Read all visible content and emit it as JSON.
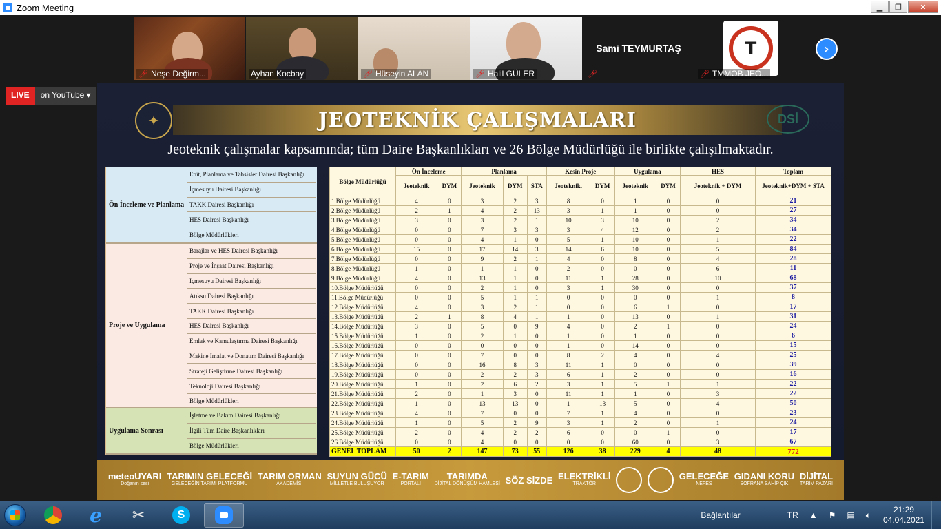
{
  "window": {
    "title": "Zoom Meeting"
  },
  "participants": [
    {
      "name": "Neşe Değirm...",
      "muted": true
    },
    {
      "name": "Ayhan Kocbay",
      "muted": false
    },
    {
      "name": "Hüseyin ALAN",
      "muted": true
    },
    {
      "name": "Halil GÜLER",
      "muted": true
    },
    {
      "name": "Sami TEYMURTAŞ",
      "muted": true
    },
    {
      "name": "TMMOB JEO...",
      "muted": true
    }
  ],
  "live": {
    "badge": "LIVE",
    "where": "on YouTube"
  },
  "slide": {
    "title": "JEOTEKNİK ÇALIŞMALARI",
    "subtitle": "Jeoteknik çalışmalar kapsamında; tüm Daire Başkanlıkları ve 26 Bölge Müdürlüğü ile birlikte çalışılmaktadır.",
    "logo_right": "DSİ",
    "groups": [
      {
        "label": "Ön İnceleme ve Planlama",
        "items": [
          "Etüt, Planlama ve Tahsisler Dairesi Başkanlığı",
          "İçmesuyu Dairesi Başkanlığı",
          "TAKK Dairesi Başkanlığı",
          "HES Dairesi Başkanlığı",
          "Bölge Müdürlükleri"
        ]
      },
      {
        "label": "Proje ve Uygulama",
        "items": [
          "Barajlar ve HES Dairesi Başkanlığı",
          "Proje ve İnşaat Dairesi Başkanlığı",
          "İçmesuyu Dairesi Başkanlığı",
          "Atıksu Dairesi Başkanlığı",
          "TAKK Dairesi Başkanlığı",
          "HES Dairesi Başkanlığı",
          "Emlak ve Kamulaştırma Dairesi Başkanlığı",
          "Makine İmalat ve Donatım Dairesi Başkanlığı",
          "Strateji Geliştirme Dairesi Başkanlığı",
          "Teknoloji Dairesi Başkanlığı",
          "Bölge Müdürlükleri"
        ]
      },
      {
        "label": "Uygulama Sonrası",
        "items": [
          "İşletme ve Bakım Dairesi Başkanlığı",
          "İlgili Tüm Daire Başkanlıkları",
          "Bölge Müdürlükleri"
        ]
      }
    ],
    "table": {
      "region_header": "Bölge Müdürlüğü",
      "group_headers": [
        "Ön İnceleme",
        "Planlama",
        "Kesin Proje",
        "Uygulama",
        "HES",
        "Toplam"
      ],
      "sub_headers": [
        "Jeoteknik",
        "DYM",
        "Jeoteknik",
        "DYM",
        "STA",
        "Jeoteknik.",
        "DYM",
        "Jeoteknik",
        "DYM",
        "Jeoteknik + DYM",
        "Jeoteknik+DYM + STA"
      ],
      "rows": [
        [
          "1.Bölge Müdürlüğü",
          "4",
          "0",
          "3",
          "2",
          "3",
          "8",
          "0",
          "1",
          "0",
          "0",
          "21"
        ],
        [
          "2.Bölge Müdürlüğü",
          "2",
          "1",
          "4",
          "2",
          "13",
          "3",
          "1",
          "1",
          "0",
          "0",
          "27"
        ],
        [
          "3.Bölge Müdürlüğü",
          "3",
          "0",
          "3",
          "2",
          "1",
          "10",
          "3",
          "10",
          "0",
          "2",
          "34"
        ],
        [
          "4.Bölge Müdürlüğü",
          "0",
          "0",
          "7",
          "3",
          "3",
          "3",
          "4",
          "12",
          "0",
          "2",
          "34"
        ],
        [
          "5.Bölge Müdürlüğü",
          "0",
          "0",
          "4",
          "1",
          "0",
          "5",
          "1",
          "10",
          "0",
          "1",
          "22"
        ],
        [
          "6.Bölge Müdürlüğü",
          "15",
          "0",
          "17",
          "14",
          "3",
          "14",
          "6",
          "10",
          "0",
          "5",
          "84"
        ],
        [
          "7.Bölge Müdürlüğü",
          "0",
          "0",
          "9",
          "2",
          "1",
          "4",
          "0",
          "8",
          "0",
          "4",
          "28"
        ],
        [
          "8.Bölge Müdürlüğü",
          "1",
          "0",
          "1",
          "1",
          "0",
          "2",
          "0",
          "0",
          "0",
          "6",
          "11"
        ],
        [
          "9.Bölge Müdürlüğü",
          "4",
          "0",
          "13",
          "1",
          "0",
          "11",
          "1",
          "28",
          "0",
          "10",
          "68"
        ],
        [
          "10.Bölge Müdürlüğü",
          "0",
          "0",
          "2",
          "1",
          "0",
          "3",
          "1",
          "30",
          "0",
          "0",
          "37"
        ],
        [
          "11.Bölge Müdürlüğü",
          "0",
          "0",
          "5",
          "1",
          "1",
          "0",
          "0",
          "0",
          "0",
          "1",
          "8"
        ],
        [
          "12.Bölge Müdürlüğü",
          "4",
          "0",
          "3",
          "2",
          "1",
          "0",
          "0",
          "6",
          "1",
          "0",
          "17"
        ],
        [
          "13.Bölge Müdürlüğü",
          "2",
          "1",
          "8",
          "4",
          "1",
          "1",
          "0",
          "13",
          "0",
          "1",
          "31"
        ],
        [
          "14.Bölge Müdürlüğü",
          "3",
          "0",
          "5",
          "0",
          "9",
          "4",
          "0",
          "2",
          "1",
          "0",
          "24"
        ],
        [
          "15.Bölge Müdürlüğü",
          "1",
          "0",
          "2",
          "1",
          "0",
          "1",
          "0",
          "1",
          "0",
          "0",
          "6"
        ],
        [
          "16.Bölge Müdürlüğü",
          "0",
          "0",
          "0",
          "0",
          "0",
          "1",
          "0",
          "14",
          "0",
          "0",
          "15"
        ],
        [
          "17.Bölge Müdürlüğü",
          "0",
          "0",
          "7",
          "0",
          "0",
          "8",
          "2",
          "4",
          "0",
          "4",
          "25"
        ],
        [
          "18.Bölge Müdürlüğü",
          "0",
          "0",
          "16",
          "8",
          "3",
          "11",
          "1",
          "0",
          "0",
          "0",
          "39"
        ],
        [
          "19.Bölge Müdürlüğü",
          "0",
          "0",
          "2",
          "2",
          "3",
          "6",
          "1",
          "2",
          "0",
          "0",
          "16"
        ],
        [
          "20.Bölge Müdürlüğü",
          "1",
          "0",
          "2",
          "6",
          "2",
          "3",
          "1",
          "5",
          "1",
          "1",
          "22"
        ],
        [
          "21.Bölge Müdürlüğü",
          "2",
          "0",
          "1",
          "3",
          "0",
          "11",
          "1",
          "1",
          "0",
          "3",
          "22"
        ],
        [
          "22.Bölge Müdürlüğü",
          "1",
          "0",
          "13",
          "13",
          "0",
          "1",
          "13",
          "5",
          "0",
          "4",
          "50"
        ],
        [
          "23.Bölge Müdürlüğü",
          "4",
          "0",
          "7",
          "0",
          "0",
          "7",
          "1",
          "4",
          "0",
          "0",
          "23"
        ],
        [
          "24.Bölge Müdürlüğü",
          "1",
          "0",
          "5",
          "2",
          "9",
          "3",
          "1",
          "2",
          "0",
          "1",
          "24"
        ],
        [
          "25.Bölge Müdürlüğü",
          "2",
          "0",
          "4",
          "2",
          "2",
          "6",
          "0",
          "0",
          "1",
          "0",
          "17"
        ],
        [
          "26.Bölge Müdürlüğü",
          "0",
          "0",
          "4",
          "0",
          "0",
          "0",
          "0",
          "60",
          "0",
          "3",
          "67"
        ]
      ],
      "grand_total": [
        "GENEL TOPLAM",
        "50",
        "2",
        "147",
        "73",
        "55",
        "126",
        "38",
        "229",
        "4",
        "48",
        "772"
      ]
    },
    "footer_logos": [
      {
        "main": "meteoUYARI",
        "sub": "Doğanın sesi"
      },
      {
        "main": "TARIMIN GELECEĞİ",
        "sub": "GELECEĞİN TARIMI PLATFORMU"
      },
      {
        "main": "TARIM ORMAN",
        "sub": "AKADEMİSİ"
      },
      {
        "main": "SUYUN GÜCÜ",
        "sub": "MİLLETLE BULUŞUYOR"
      },
      {
        "main": "E-TARIM",
        "sub": "PORTALI"
      },
      {
        "main": "TARIMDA",
        "sub": "DİJİTAL DÖNÜŞÜM HAMLESİ"
      },
      {
        "main": "SÖZ SİZDE",
        "sub": ""
      },
      {
        "main": "ELEKTRİKLİ",
        "sub": "TRAKTÖR"
      },
      {
        "main": "",
        "sub": ""
      },
      {
        "main": "",
        "sub": ""
      },
      {
        "main": "GELECEĞE",
        "sub": "NEFES"
      },
      {
        "main": "GIDANI KORU",
        "sub": "SOFRANA SAHİP ÇIK"
      },
      {
        "main": "DİJİTAL",
        "sub": "TARIM PAZARI"
      }
    ]
  },
  "taskbar": {
    "apps": [
      "chrome-icon",
      "internet-explorer-icon",
      "snipping-tool-icon",
      "skype-icon",
      "zoom-icon"
    ],
    "tray": {
      "links": "Bağlantılar",
      "lang": "TR"
    },
    "clock": {
      "time": "21:29",
      "date": "04.04.2021"
    }
  }
}
